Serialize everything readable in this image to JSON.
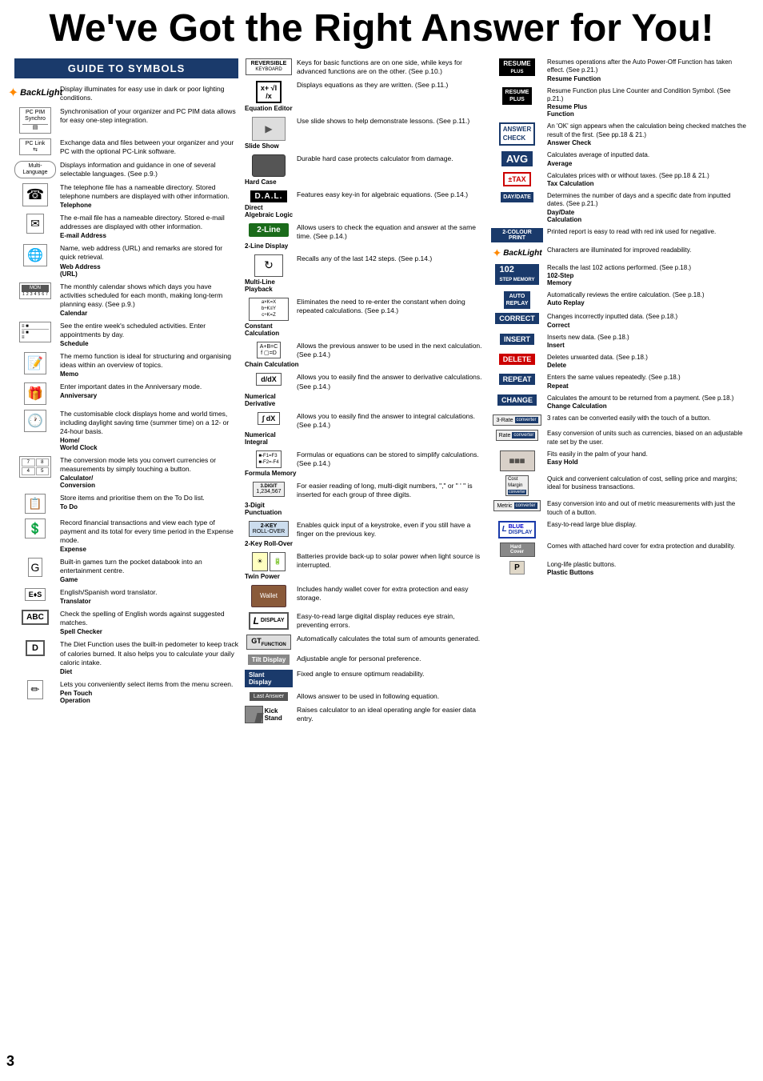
{
  "page": {
    "title": "We've Got the Right Answer for You!",
    "page_number": "3"
  },
  "guide": {
    "header": "GUIDE TO SYMBOLS"
  },
  "left_col": [
    {
      "id": "backlight",
      "icon_type": "backlight",
      "name": "",
      "desc": "Display illuminates for easy use in dark or poor lighting conditions."
    },
    {
      "id": "pc-pim",
      "icon_type": "text-box",
      "icon_text": "PC PIM\nSynchro",
      "name": "",
      "desc": "Synchronisation of your organizer and PC PIM data allows for easy one-step integration."
    },
    {
      "id": "pc-link",
      "icon_type": "text-box",
      "icon_text": "PC Link",
      "name": "",
      "desc": "Exchange data and files between your organizer and your PC with the optional PC-Link software."
    },
    {
      "id": "multi-language",
      "icon_type": "multi-lang",
      "name": "",
      "desc": "Displays information and guidance in one of several selectable languages. (See p.9.)"
    },
    {
      "id": "telephone",
      "icon_type": "phone",
      "name": "Telephone",
      "desc": "The telephone file has a nameable directory. Stored telephone numbers are displayed with other information."
    },
    {
      "id": "email",
      "icon_type": "email",
      "name": "E-mail Address",
      "desc": "The e-mail file has a nameable directory. Stored e-mail addresses are displayed with other information."
    },
    {
      "id": "web",
      "icon_type": "web",
      "name": "Web Address\n(URL)",
      "desc": "Name, web address (URL) and remarks are stored for quick retrieval."
    },
    {
      "id": "calendar",
      "icon_type": "calendar",
      "name": "Calendar",
      "desc": "The monthly calendar shows which days you have activities scheduled for each month, making long-term planning easy. (See p.9.)"
    },
    {
      "id": "schedule",
      "icon_type": "schedule",
      "name": "Schedule",
      "desc": "See the entire week's scheduled activities. Enter appointments by day."
    },
    {
      "id": "memo",
      "icon_type": "memo",
      "name": "Memo",
      "desc": "The memo function is ideal for structuring and organising ideas within an overview of topics."
    },
    {
      "id": "anniversary",
      "icon_type": "anniversary",
      "name": "Anniversary",
      "desc": "Enter important dates in the Anniversary mode."
    },
    {
      "id": "worldclock",
      "icon_type": "worldclock",
      "name": "Home/\nWorld Clock",
      "desc": "The customisable clock displays home and world times, including daylight saving time (summer time) on a 12- or 24-hour basis."
    },
    {
      "id": "conversion",
      "icon_type": "conversion",
      "name": "Calculator/\nConversion",
      "desc": "The conversion mode lets you convert currencies or measurements by simply touching a button."
    },
    {
      "id": "todo",
      "icon_type": "todo",
      "name": "To Do",
      "desc": "Store items and prioritise them on the To Do list."
    },
    {
      "id": "expense",
      "icon_type": "expense",
      "name": "Expense",
      "desc": "Record financial transactions and view each type of payment and its total for every time period in the Expense mode."
    },
    {
      "id": "game",
      "icon_type": "game",
      "name": "Game",
      "desc": "Built-in games turn the pocket databook into an entertainment centre."
    },
    {
      "id": "translator",
      "icon_type": "translator",
      "name": "Translator",
      "desc": "English/Spanish word translator."
    },
    {
      "id": "spellchecker",
      "icon_type": "spellchecker",
      "name": "Spell Checker",
      "desc": "Check the spelling of English words against suggested matches."
    },
    {
      "id": "diet",
      "icon_type": "diet",
      "name": "Diet",
      "desc": "The Diet Function uses the built-in pedometer to keep track of calories burned. It also helps you to calculate your daily caloric intake."
    },
    {
      "id": "pentouch",
      "icon_type": "pentouch",
      "name": "Pen Touch\nOperation",
      "desc": "Lets you conveniently select items from the menu screen."
    }
  ],
  "mid_col": [
    {
      "id": "reversible-keyboard",
      "icon_type": "reversible-keyboard",
      "name": "",
      "desc": "Keys for basic functions are on one side, while keys for advanced functions are on the other. (See p.10.)"
    },
    {
      "id": "equation-editor",
      "icon_type": "equation-editor",
      "label": "x+ √I/x",
      "name": "Equation Editor",
      "desc": "Displays equations as they are written. (See p.11.)"
    },
    {
      "id": "slideshow",
      "icon_type": "slideshow",
      "name": "Slide Show",
      "desc": "Use slide shows to help demonstrate lessons. (See p.11.)"
    },
    {
      "id": "hardcase",
      "icon_type": "hardcase",
      "name": "Hard Case",
      "desc": "Durable hard case protects calculator from damage."
    },
    {
      "id": "dal",
      "icon_type": "dal",
      "name": "Direct\nAlgebraic Logic",
      "desc": "Features easy key-in for algebraic equations. (See p.14.)"
    },
    {
      "id": "2line",
      "icon_type": "2line",
      "name": "2-Line Display",
      "desc": "Allows users to check the equation and answer at the same time. (See p.14.)"
    },
    {
      "id": "multiline",
      "icon_type": "multiline",
      "name": "Multi-Line\nPlayback",
      "desc": "Recalls any of the last 142 steps. (See p.14.)"
    },
    {
      "id": "constant",
      "icon_type": "constant",
      "name": "Constant\nCalculation",
      "desc": "Eliminates the need to re-enter the constant when doing repeated calculations. (See p.14.)"
    },
    {
      "id": "chain",
      "icon_type": "chain",
      "name": "Chain Calculation",
      "desc": "Allows the previous answer to be used in the next calculation. (See p.14.)"
    },
    {
      "id": "deriv",
      "icon_type": "deriv",
      "name": "Numerical\nDerivative",
      "desc": "Allows you to easily find the answer to derivative calculations. (See p.14.)"
    },
    {
      "id": "integral",
      "icon_type": "integral",
      "name": "Numerical\nIntegral",
      "desc": "Allows you to easily find the answer to integral calculations. (See p.14.)"
    },
    {
      "id": "formula",
      "icon_type": "formula",
      "name": "Formula Memory",
      "desc": "Formulas or equations can be stored to simplify calculations. (See p.14.)"
    },
    {
      "id": "3digit",
      "icon_type": "3digit",
      "name": "3-Digit\nPunctuation",
      "desc": "For easier reading of long, multi-digit numbers, \",\" or \" ' \" is inserted for each group of three digits."
    },
    {
      "id": "2key",
      "icon_type": "2key",
      "name": "2-Key Roll-Over",
      "desc": "Enables quick input of a keystroke, even if you still have a finger on the previous key."
    },
    {
      "id": "twinpower",
      "icon_type": "twinpower",
      "name": "Twin Power",
      "desc": "Batteries provide back-up to solar power when light source is interrupted."
    },
    {
      "id": "wallet",
      "icon_type": "wallet",
      "name": "",
      "desc": "Includes handy wallet cover for extra protection and easy storage."
    },
    {
      "id": "display",
      "icon_type": "display",
      "name": "",
      "desc": "Easy-to-read large digital display reduces eye strain, preventing errors."
    },
    {
      "id": "gt",
      "icon_type": "gt",
      "name": "",
      "desc": "Automatically calculates the total sum of amounts generated."
    },
    {
      "id": "tiltdisplay",
      "icon_type": "tiltdisplay",
      "name": "",
      "desc": "Adjustable angle for personal preference."
    },
    {
      "id": "slantdisplay",
      "icon_type": "slantdisplay",
      "name": "",
      "desc": "Fixed angle to ensure optimum readability."
    },
    {
      "id": "lastanswer",
      "icon_type": "lastanswer",
      "name": "",
      "desc": "Allows answer to be used in following equation."
    },
    {
      "id": "kickstand",
      "icon_type": "kickstand",
      "name": "",
      "desc": "Raises calculator to an ideal operating angle for easier data entry."
    }
  ],
  "right_col": [
    {
      "id": "resume",
      "badge_type": "resume",
      "name": "Resume Function",
      "desc": "Resumes operations after the Auto Power-Off Function has taken effect. (See p.21.)"
    },
    {
      "id": "resume-plus",
      "badge_type": "resume-plus",
      "name": "Resume Plus\nFunction",
      "desc": "Resume Function plus Line Counter and Condition Symbol. (See p.21.)"
    },
    {
      "id": "answer-check",
      "badge_type": "answer-check",
      "name": "Answer Check",
      "desc": "An 'OK' sign appears when the calculation being checked matches the result of the first. (See pp.18 & 21.)"
    },
    {
      "id": "avg",
      "badge_type": "avg",
      "name": "Average",
      "desc": "Calculates average of inputted data."
    },
    {
      "id": "tax",
      "badge_type": "tax",
      "name": "Tax Calculation",
      "desc": "Calculates prices with or without taxes. (See pp.18 & 21.)"
    },
    {
      "id": "daydate",
      "badge_type": "daydate",
      "name": "Day/Date\nCalculation",
      "desc": "Determines the number of days and a specific date from inputted dates. (See p.21.)"
    },
    {
      "id": "colour-print",
      "badge_type": "colour-print",
      "name": "",
      "desc": "Printed report is easy to read with red ink used for negative."
    },
    {
      "id": "backlight2",
      "badge_type": "backlight2",
      "name": "",
      "desc": "Characters are illuminated for improved readability."
    },
    {
      "id": "step-memory",
      "badge_type": "step-memory",
      "name": "102-Step\nMemory",
      "desc": "Recalls the last 102 actions performed. (See p.18.)"
    },
    {
      "id": "autoreplay",
      "badge_type": "autoreplay",
      "name": "Auto Replay",
      "desc": "Automatically reviews the entire calculation. (See p.18.)"
    },
    {
      "id": "correct",
      "badge_type": "correct",
      "name": "Correct",
      "desc": "Changes incorrectly inputted data. (See p.18.)"
    },
    {
      "id": "insert",
      "badge_type": "insert",
      "name": "Insert",
      "desc": "Inserts new data. (See p.18.)"
    },
    {
      "id": "delete",
      "badge_type": "delete",
      "name": "Delete",
      "desc": "Deletes unwanted data. (See p.18.)"
    },
    {
      "id": "repeat",
      "badge_type": "repeat",
      "name": "Repeat",
      "desc": "Enters the same values repeatedly. (See p.18.)"
    },
    {
      "id": "change",
      "badge_type": "change",
      "name": "Change Calculation",
      "desc": "Calculates the amount to be returned from a payment. (See p.18.)"
    },
    {
      "id": "3rate",
      "badge_type": "3rate",
      "name": "",
      "desc": "3 rates can be converted easily with the touch of a button."
    },
    {
      "id": "rate",
      "badge_type": "rate",
      "name": "",
      "desc": "Easy conversion of units such as currencies, biased on an adjustable rate set by the user."
    },
    {
      "id": "easyhold",
      "badge_type": "easyhold",
      "name": "Easy Hold",
      "desc": "Fits easily in the palm of your hand."
    },
    {
      "id": "costmargin",
      "badge_type": "costmargin",
      "name": "",
      "desc": "Quick and convenient calculation of cost, selling price and margins; ideal for business transactions."
    },
    {
      "id": "metric",
      "badge_type": "metric",
      "name": "",
      "desc": "Easy conversion into and out of metric measurements with just the touch of a button."
    },
    {
      "id": "bluedisplay",
      "badge_type": "bluedisplay",
      "name": "",
      "desc": "Easy-to-read large blue display."
    },
    {
      "id": "hardcover",
      "badge_type": "hardcover",
      "name": "",
      "desc": "Comes with attached hard cover for extra protection and durability."
    },
    {
      "id": "plastic",
      "badge_type": "plastic",
      "name": "Plastic Buttons",
      "desc": "Long-life plastic buttons."
    }
  ]
}
